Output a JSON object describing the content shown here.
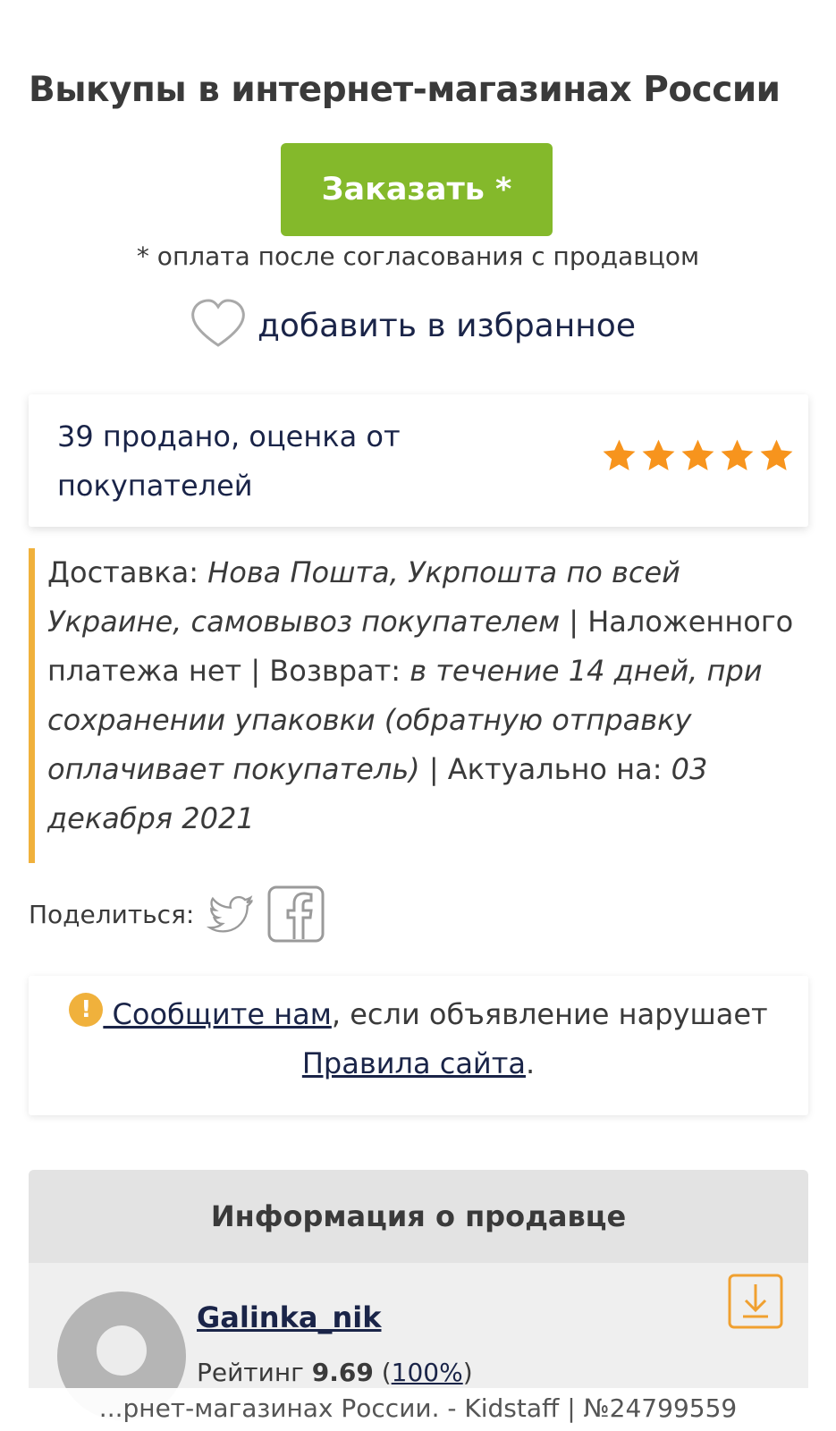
{
  "page": {
    "title": "Выкупы в интернет-магазинах России"
  },
  "order": {
    "button_label": "Заказать *",
    "payment_note": "* оплата после согласования с продавцом"
  },
  "favorite": {
    "label": "добавить в избранное",
    "icon": "heart-outline-icon"
  },
  "sales": {
    "text": "39 продано, оценка от покупателей",
    "rating_stars": 5,
    "star_color": "#f7941d"
  },
  "delivery": {
    "label": "Доставка: ",
    "methods": "Нова Пошта, Укрпошта по всей Украине, самовывоз покупателем",
    "cod": " | Наложенного платежа нет | Возврат: ",
    "return_policy": "в течение 14 дней, при сохранении упаковки (обратную отправку оплачивает покупатель)",
    "actual_label": " | Актуально на: ",
    "actual_date": "03 декабря 2021",
    "accent_color": "#f0b13c"
  },
  "share": {
    "label": "Поделиться:",
    "icons": [
      "twitter-icon",
      "facebook-icon"
    ]
  },
  "report": {
    "icon": "!",
    "link_text": " Сообщите нам",
    "text_middle": ", если объявление нарушает ",
    "rules_link": "Правила сайта",
    "text_end": "."
  },
  "seller": {
    "section_title": "Информация о продавце",
    "name": "Galinka_nik",
    "rating_label": "Рейтинг ",
    "rating_value": "9.69",
    "rating_open": " (",
    "rating_percent": "100%",
    "rating_close": ")"
  },
  "footer": {
    "text": "...рнет-магазинах России. - Kidstaff | №24799559"
  },
  "colors": {
    "order_button": "#84b92b",
    "accent": "#f0b13c",
    "link": "#1a2448"
  }
}
